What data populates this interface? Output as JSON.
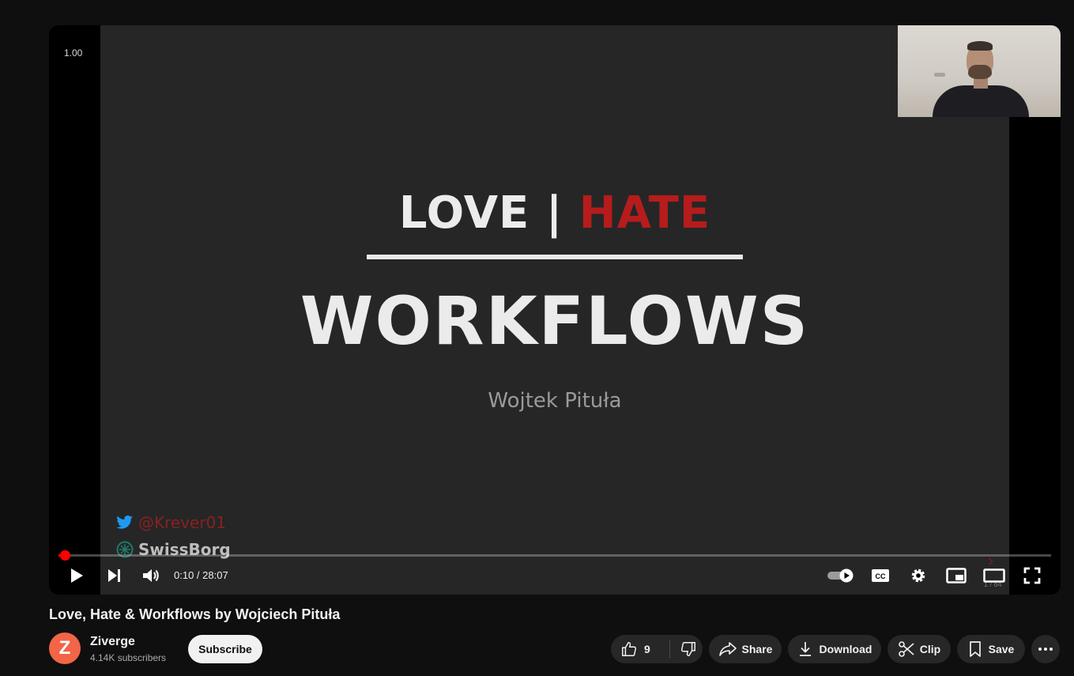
{
  "player": {
    "speed_label": "1.00",
    "slide": {
      "title_love": "LOVE",
      "title_sep": "|",
      "title_hate": "HATE",
      "title_main": "WORKFLOWS",
      "author": "Wojtek Pituła",
      "twitter_handle": "@Krever01",
      "brand": "SwissBorg",
      "counter": "1 / 84"
    },
    "progress": {
      "played_fraction": 0.006,
      "buffered_fraction": 0.009
    },
    "time_display": "0:10 / 28:07",
    "icons": {
      "play": "play-icon",
      "next": "next-icon",
      "volume": "volume-icon",
      "autoplay": "autoplay-toggle-icon",
      "captions": "captions-icon",
      "settings": "gear-icon",
      "miniplayer": "miniplayer-icon",
      "theater": "theater-mode-icon",
      "fullscreen": "fullscreen-icon"
    },
    "colors": {
      "progress": "#ff0000",
      "hate": "#b61c1c",
      "twitter": "#1d9bf0"
    }
  },
  "video": {
    "title": "Love, Hate & Workflows by Wojciech Pituła"
  },
  "channel": {
    "avatar_letter": "Z",
    "name": "Ziverge",
    "subscribers": "4.14K subscribers",
    "subscribe_label": "Subscribe"
  },
  "actions": {
    "like_count": "9",
    "share_label": "Share",
    "download_label": "Download",
    "clip_label": "Clip",
    "save_label": "Save"
  }
}
